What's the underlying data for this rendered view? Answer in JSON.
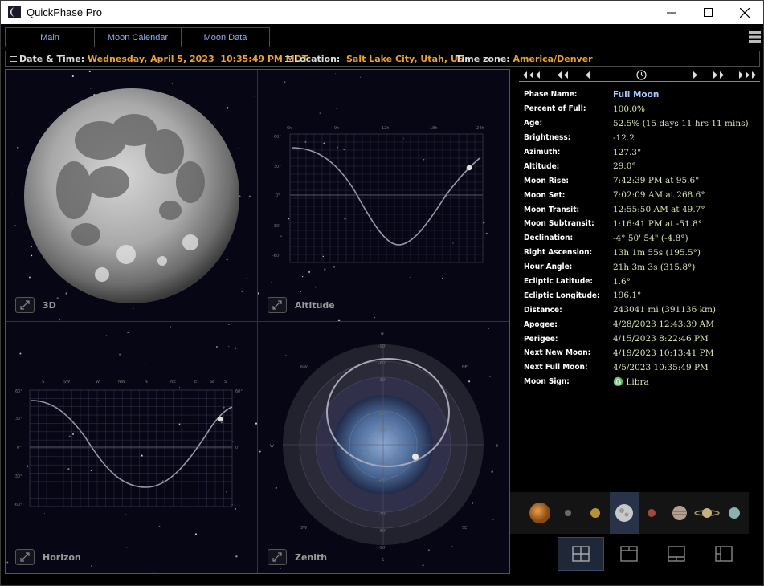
{
  "app": {
    "title": "QuickPhase Pro"
  },
  "tabs": [
    {
      "label": "Main"
    },
    {
      "label": "Moon Calendar"
    },
    {
      "label": "Moon Data"
    }
  ],
  "infobar": {
    "date_label": "Date & Time:",
    "date_value": "Wednesday, April 5, 2023  10:35:49 PM MDT",
    "location_label": "Location:",
    "location_value": "Salt Lake City, Utah, US",
    "timezone_label": "Time zone:",
    "timezone_value": "America/Denver"
  },
  "views": [
    {
      "label": "3D"
    },
    {
      "label": "Altitude"
    },
    {
      "label": "Horizon"
    },
    {
      "label": "Zenith"
    }
  ],
  "moon_data": [
    {
      "label": "Phase Name:",
      "value": "Full Moon"
    },
    {
      "label": "Percent of Full:",
      "value": "100.0%"
    },
    {
      "label": "Age:",
      "value": "52.5% (15 days 11 hrs 11 mins)"
    },
    {
      "label": "Brightness:",
      "value": "-12.2"
    },
    {
      "label": "Azimuth:",
      "value": "127.3°"
    },
    {
      "label": "Altitude:",
      "value": "29.0°"
    },
    {
      "label": "Moon Rise:",
      "value": "7:42:39 PM at 95.6°"
    },
    {
      "label": "Moon Set:",
      "value": "7:02:09 AM at 268.6°"
    },
    {
      "label": "Moon Transit:",
      "value": "12:55:50 AM at 49.7°"
    },
    {
      "label": "Moon Subtransit:",
      "value": "1:16:41 PM at -51.8°"
    },
    {
      "label": "Declination:",
      "value": "-4° 50' 54\" (-4.8°)"
    },
    {
      "label": "Right Ascension:",
      "value": "13h 1m 55s (195.5°)"
    },
    {
      "label": "Hour Angle:",
      "value": "21h 3m 3s (315.8°)"
    },
    {
      "label": "Ecliptic Latitude:",
      "value": "1.6°"
    },
    {
      "label": "Ecliptic Longitude:",
      "value": "196.1°"
    },
    {
      "label": "Distance:",
      "value": "243041 mi (391136 km)"
    },
    {
      "label": "Apogee:",
      "value": "4/28/2023  12:43:39 AM"
    },
    {
      "label": "Perigee:",
      "value": "4/15/2023  8:22:46 PM"
    },
    {
      "label": "Next New Moon:",
      "value": "4/19/2023  10:13:41 PM"
    },
    {
      "label": "Next Full Moon:",
      "value": "4/5/2023  10:35:49 PM"
    },
    {
      "label": "Moon Sign:",
      "value": "♎ Libra"
    }
  ],
  "altitude_chart": {
    "x_ticks": [
      "6h",
      "9h",
      "12h",
      "18h",
      "24h"
    ],
    "y_ticks": [
      "60°",
      "30°",
      "0°",
      "-30°",
      "-60°"
    ]
  },
  "horizon_chart": {
    "x_ticks": [
      "S",
      "SW",
      "W",
      "NW",
      "N",
      "NE",
      "E",
      "SE",
      "S"
    ],
    "y_ticks": [
      "60°",
      "30°",
      "0°",
      "-30°",
      "-60°"
    ]
  },
  "zenith_chart": {
    "compass": [
      "N",
      "NW",
      "NE",
      "W",
      "E",
      "SW",
      "SE",
      "S"
    ],
    "rings": [
      "-90°",
      "-60°",
      "-30°",
      "+30°",
      "+60°",
      "+60°",
      "+30°",
      "-30°",
      "-60°",
      "-90°"
    ]
  },
  "planets": [
    "sun-icon",
    "mercury-icon",
    "venus-icon",
    "moon-icon",
    "mars-icon",
    "jupiter-icon",
    "saturn-icon",
    "uranus-icon"
  ],
  "colors": {
    "accent": "#f0a030",
    "link": "#8fb0f0",
    "value": "#d6e8b0",
    "phase": "#a8c8ff"
  }
}
